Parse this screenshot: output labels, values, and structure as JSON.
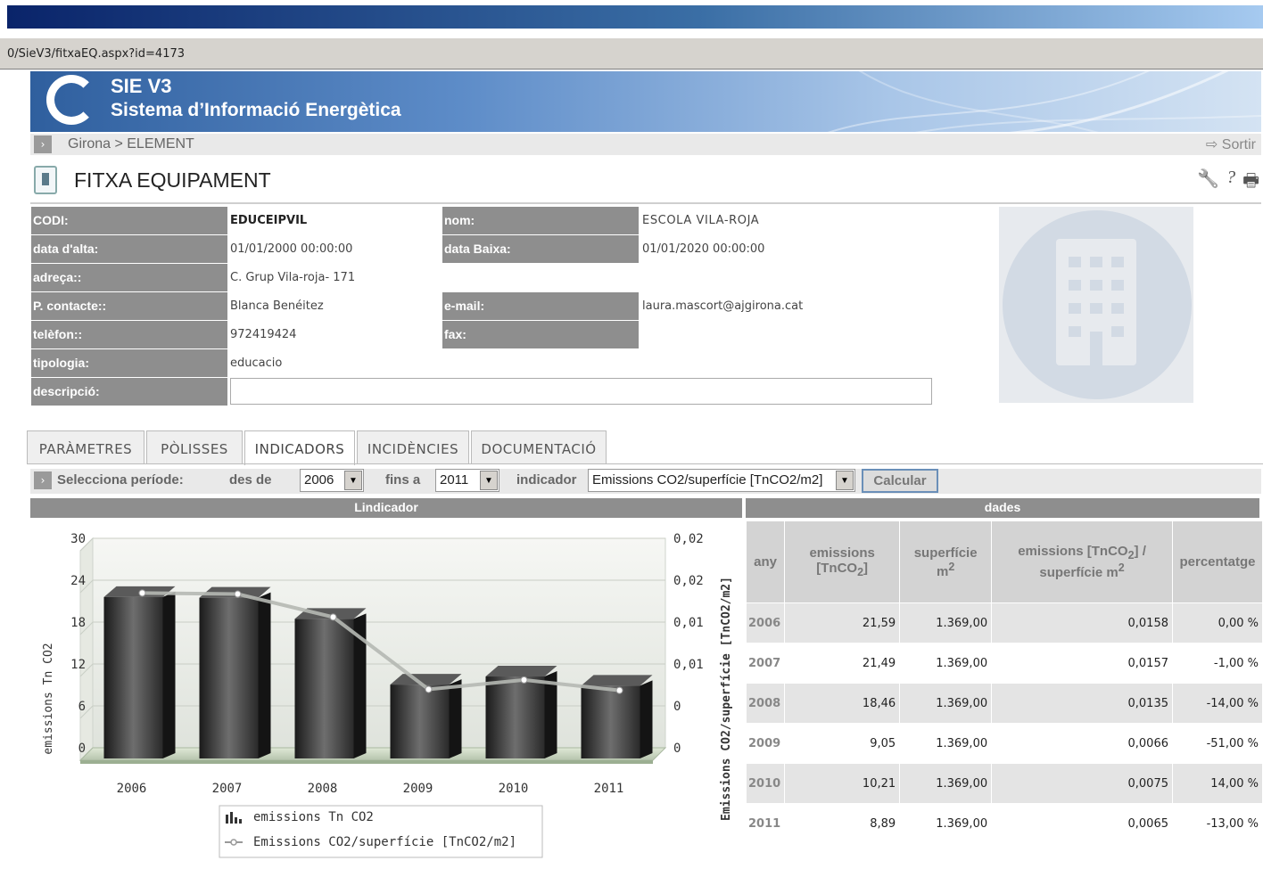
{
  "browser": {
    "url": "0/SieV3/fitxaEQ.aspx?id=4173"
  },
  "header": {
    "title": "SIE V3",
    "subtitle": "Sistema d’Informació Energètica"
  },
  "breadcrumb": {
    "text": "Girona > ELEMENT",
    "logout": "Sortir",
    "arrow": "›"
  },
  "page": {
    "title": "FITXA EQUIPAMENT"
  },
  "toolbar": {
    "wrench": "🔧",
    "help": "?",
    "print": "🖶"
  },
  "fields": {
    "codi": {
      "label": "CODI:",
      "value": "EDUCEIPVIL"
    },
    "nom": {
      "label": "nom:",
      "value": "ESCOLA VILA-ROJA"
    },
    "data_alta": {
      "label": "data d'alta:",
      "value": "01/01/2000 00:00:00"
    },
    "data_baixa": {
      "label": "data Baixa:",
      "value": "01/01/2020 00:00:00"
    },
    "adreca": {
      "label": "adreça::",
      "value": "C. Grup Vila-roja- 171"
    },
    "contacte": {
      "label": "P. contacte::",
      "value": "Blanca Benéitez"
    },
    "email": {
      "label": "e-mail:",
      "value": "laura.mascort@ajgirona.cat"
    },
    "telefon": {
      "label": "telèfon::",
      "value": "972419424"
    },
    "fax": {
      "label": "fax:",
      "value": ""
    },
    "tipologia": {
      "label": "tipologia:",
      "value": "educacio"
    },
    "descripcio": {
      "label": "descripció:",
      "value": ""
    }
  },
  "tabs": [
    {
      "label": "PARÀMETRES"
    },
    {
      "label": "PÒLISSES"
    },
    {
      "label": "INDICADORS"
    },
    {
      "label": "INCIDÈNCIES"
    },
    {
      "label": "DOCUMENTACIÓ"
    }
  ],
  "filter": {
    "arrow": "›",
    "period_label": "Selecciona període:",
    "from_label": "des de",
    "from_value": "2006",
    "to_label": "fins a",
    "to_value": "2011",
    "indicator_label": "indicador",
    "indicator_value": "Emissions CO2/superfície [TnCO2/m2]",
    "calc_label": "Calcular",
    "dropdown_glyph": "▼"
  },
  "sections": {
    "chart": "Lindicador",
    "data": "dades"
  },
  "chart_data": {
    "type": "bar",
    "categories": [
      "2006",
      "2007",
      "2008",
      "2009",
      "2010",
      "2011"
    ],
    "series": [
      {
        "name": "emissions Tn CO2",
        "type": "bar",
        "axis": "left",
        "values": [
          21.59,
          21.49,
          18.46,
          9.05,
          10.21,
          8.89
        ]
      },
      {
        "name": "Emissions CO2/superfície [TnCO2/m2]",
        "type": "line",
        "axis": "right",
        "values": [
          0.0158,
          0.0157,
          0.0135,
          0.0066,
          0.0075,
          0.0065
        ]
      }
    ],
    "ylabel": "emissions Tn CO2",
    "y2label": "Emissions CO2/superfície [TnCO2/m2]",
    "yticks": [
      "0",
      "6",
      "12",
      "18",
      "24",
      "30"
    ],
    "y2ticks": [
      "0",
      "0",
      "0,01",
      "0,01",
      "0,02",
      "0,02"
    ],
    "ylim": [
      0,
      30
    ],
    "y2lim": [
      0,
      0.02
    ],
    "grid": true,
    "legend": "bottom"
  },
  "table": {
    "headers": {
      "any": "any",
      "emissions": "emissions",
      "emissions_unit": "[TnCO",
      "emissions_sub": "2",
      "emissions_close": "]",
      "superficie": "superfície",
      "superficie_unit": "m",
      "superficie_sup": "2",
      "ratio_a": "emissions [TnCO",
      "ratio_sub": "2",
      "ratio_b": "] /",
      "ratio_c": "superfície m",
      "ratio_sup": "2",
      "percentatge": "percentatge"
    },
    "rows": [
      {
        "any": "2006",
        "emissions": "21,59",
        "superficie": "1.369,00",
        "ratio": "0,0158",
        "pct": "0,00 %"
      },
      {
        "any": "2007",
        "emissions": "21,49",
        "superficie": "1.369,00",
        "ratio": "0,0157",
        "pct": "-1,00 %"
      },
      {
        "any": "2008",
        "emissions": "18,46",
        "superficie": "1.369,00",
        "ratio": "0,0135",
        "pct": "-14,00 %"
      },
      {
        "any": "2009",
        "emissions": "9,05",
        "superficie": "1.369,00",
        "ratio": "0,0066",
        "pct": "-51,00 %"
      },
      {
        "any": "2010",
        "emissions": "10,21",
        "superficie": "1.369,00",
        "ratio": "0,0075",
        "pct": "14,00 %"
      },
      {
        "any": "2011",
        "emissions": "8,89",
        "superficie": "1.369,00",
        "ratio": "0,0065",
        "pct": "-13,00 %"
      }
    ]
  }
}
